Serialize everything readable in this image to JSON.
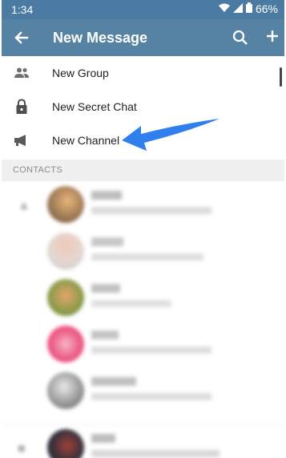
{
  "status_bar": {
    "time": "1:34",
    "battery": "66%"
  },
  "app_bar": {
    "title": "New Message"
  },
  "menu": {
    "items": [
      {
        "label": "New Group",
        "icon": "group-icon"
      },
      {
        "label": "New Secret Chat",
        "icon": "lock-icon"
      },
      {
        "label": "New Channel",
        "icon": "megaphone-icon"
      }
    ]
  },
  "section": {
    "contacts_header": "CONTACTS"
  },
  "colors": {
    "status_bar": "#4b7aa3",
    "app_bar": "#5682a3",
    "arrow": "#2f80ed",
    "section_bg": "#f0f0f0"
  }
}
